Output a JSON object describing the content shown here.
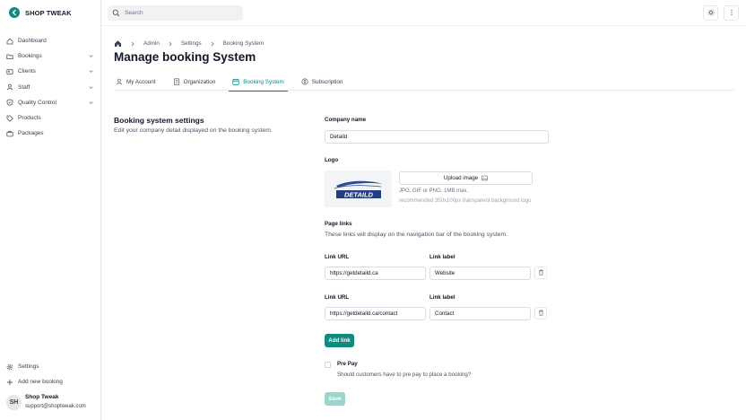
{
  "brand": {
    "name": "SHOP TWEAK",
    "logo_glyph": "<",
    "accent": "#0f8a7e"
  },
  "search": {
    "placeholder": "Search"
  },
  "sidebar": {
    "items": [
      {
        "label": "Dashboard",
        "icon": "home-icon",
        "expandable": false
      },
      {
        "label": "Bookings",
        "icon": "folder-icon",
        "expandable": true
      },
      {
        "label": "Clients",
        "icon": "users-icon",
        "expandable": true
      },
      {
        "label": "Staff",
        "icon": "user-icon",
        "expandable": true
      },
      {
        "label": "Quality Control",
        "icon": "shield-icon",
        "expandable": true
      },
      {
        "label": "Products",
        "icon": "tag-icon",
        "expandable": false
      },
      {
        "label": "Packages",
        "icon": "briefcase-icon",
        "expandable": false
      }
    ],
    "bottom_items": [
      {
        "label": "Settings",
        "icon": "gear-icon"
      },
      {
        "label": "Add new booking",
        "icon": "plus-icon"
      }
    ],
    "user": {
      "initials": "SH",
      "name": "Shop Tweak",
      "email": "support@shoptweak.com"
    }
  },
  "breadcrumb": {
    "items": [
      "Admin",
      "Settings",
      "Booking System"
    ]
  },
  "page": {
    "title": "Manage booking System"
  },
  "tabs": [
    {
      "label": "My Account",
      "icon": "user-icon",
      "active": false
    },
    {
      "label": "Organization",
      "icon": "building-icon",
      "active": false
    },
    {
      "label": "Booking System",
      "icon": "calendar-icon",
      "active": true
    },
    {
      "label": "Subscription",
      "icon": "dollar-icon",
      "active": false
    }
  ],
  "settings": {
    "title": "Booking system settings",
    "description": "Edit your company detail displayed on the booking system.",
    "company_name_label": "Company name",
    "company_name_value": "Detaild",
    "logo_label": "Logo",
    "logo_text": "DETAILD",
    "upload_label": "Upload image",
    "upload_hint": "JPG, GIF or PNG. 1MB max.",
    "upload_hint2": "recommended 350x100px transparent background logo",
    "page_links_label": "Page links",
    "page_links_desc": "These links will display on the navigation bar of the booking system.",
    "links": [
      {
        "url_label": "Link URL",
        "label_label": "Link label",
        "url": "https://getdetaild.ca",
        "label": "Website"
      },
      {
        "url_label": "Link URL",
        "label_label": "Link label",
        "url": "https://getdetaild.ca/contact",
        "label": "Contact"
      }
    ],
    "add_link": "Add link",
    "prepay_label": "Pre Pay",
    "prepay_desc": "Should customers have to pre pay to place a booking?",
    "prepay_checked": false,
    "save": "Save"
  }
}
